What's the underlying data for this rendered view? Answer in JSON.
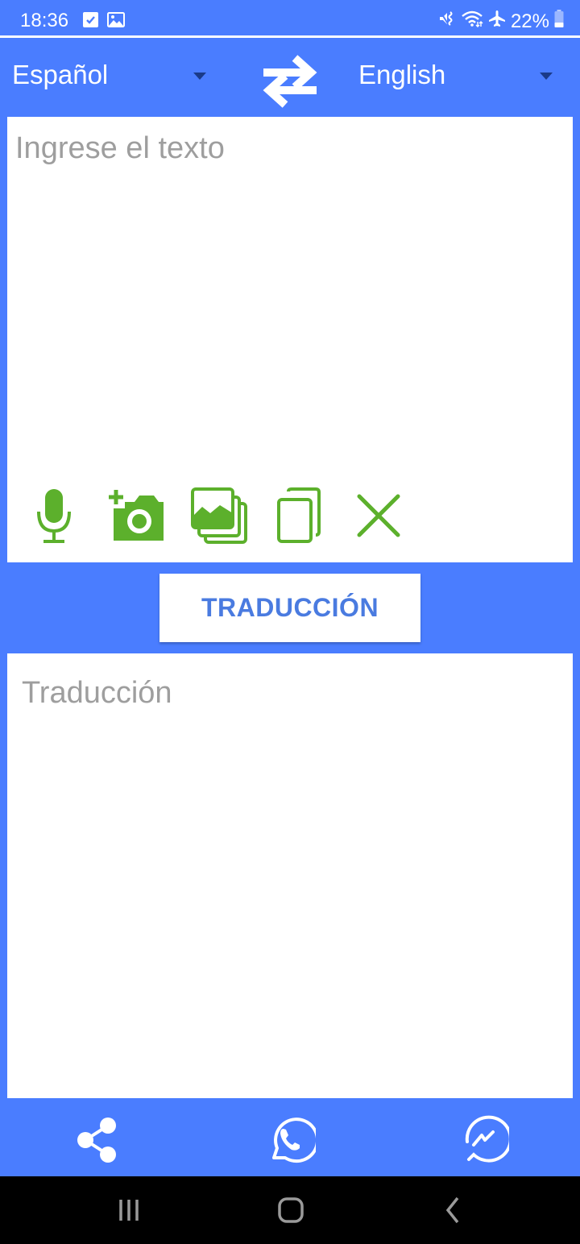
{
  "status_bar": {
    "time": "18:36",
    "left_icons": [
      "checkbox-notification-icon",
      "image-notification-icon"
    ],
    "right_icons": [
      "vibrate-mute-icon",
      "wifi-icon",
      "airplane-mode-icon"
    ],
    "battery": "22%"
  },
  "language_bar": {
    "source_language": "Español",
    "target_language": "English",
    "swap_icon": "swap-arrows-icon"
  },
  "input": {
    "value": "",
    "placeholder": "Ingrese el texto"
  },
  "tools": [
    {
      "name": "microphone-icon",
      "action": "voice-input"
    },
    {
      "name": "add-camera-icon",
      "action": "camera-input"
    },
    {
      "name": "image-gallery-icon",
      "action": "image-input"
    },
    {
      "name": "copy-icon",
      "action": "copy"
    },
    {
      "name": "close-icon",
      "action": "clear"
    }
  ],
  "translate_button": {
    "label": "TRADUCCIÓN"
  },
  "output": {
    "placeholder": "Traducción"
  },
  "share_bar": {
    "items": [
      "share-icon",
      "whatsapp-icon",
      "messenger-icon"
    ]
  },
  "nav_bar": {
    "items": [
      "recent-apps-icon",
      "home-icon",
      "back-icon"
    ]
  },
  "colors": {
    "background": "#4a7dff",
    "tool_icon": "#5cb02c",
    "button_text": "#4a7be0",
    "placeholder": "#9e9e9e"
  }
}
